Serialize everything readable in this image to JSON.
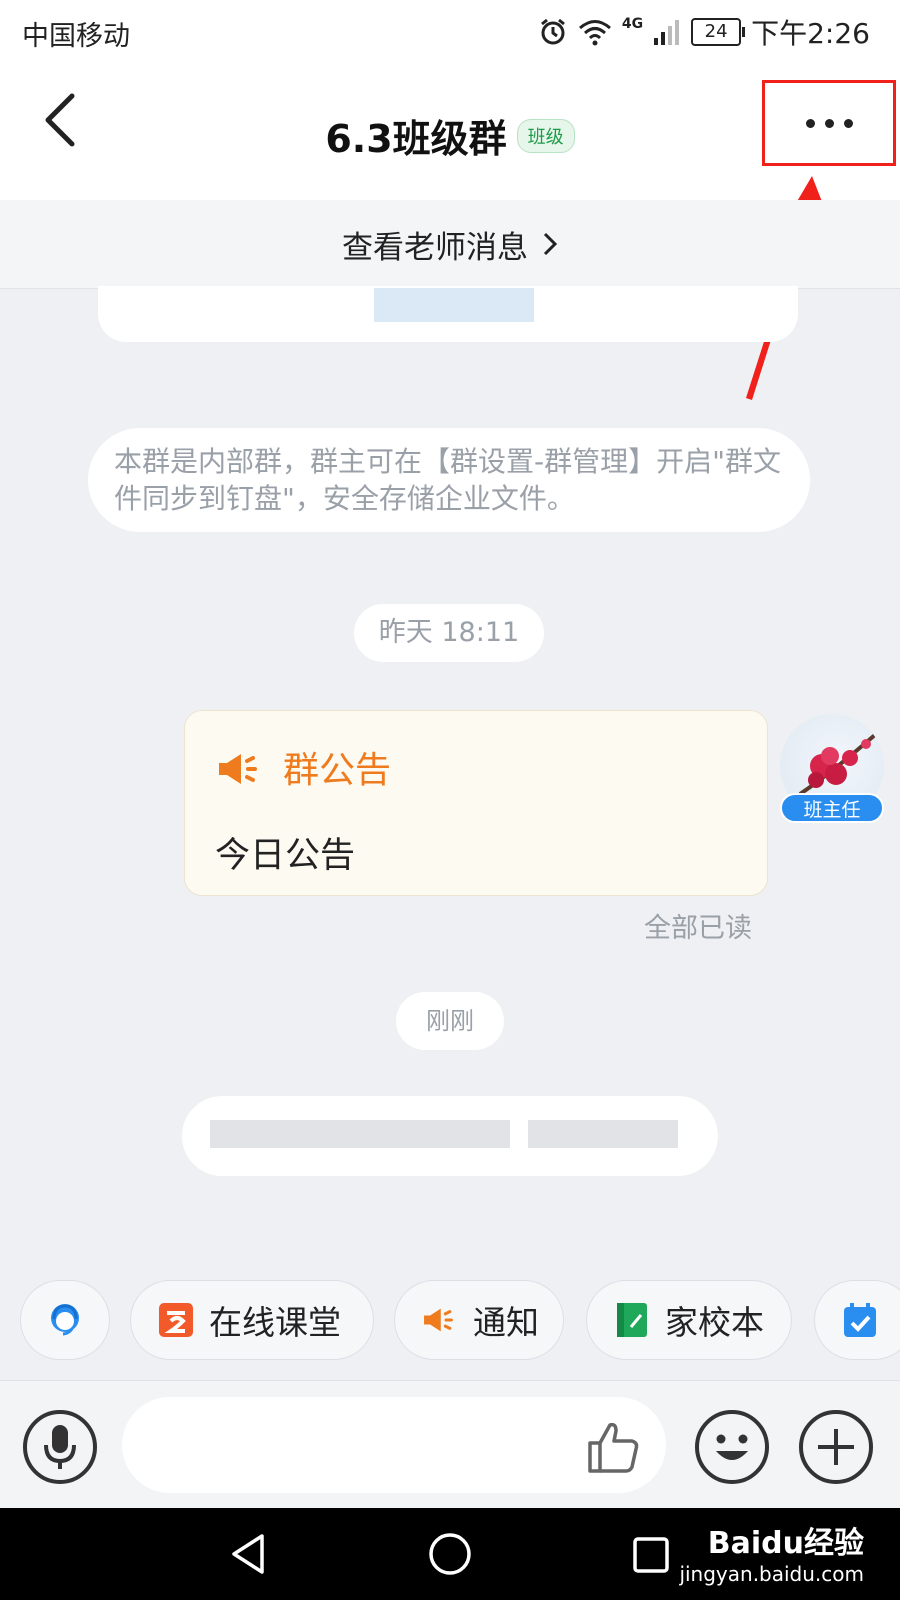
{
  "status_bar": {
    "carrier": "中国移动",
    "network": "4G",
    "battery": "24",
    "time": "下午2:26"
  },
  "header": {
    "title": "6.3班级群",
    "tag": "班级"
  },
  "teacher_bar": {
    "label": "查看老师消息"
  },
  "chat": {
    "system_notice": "本群是内部群，群主可在【群设置-群管理】开启\"群文件同步到钉盘\"，安全存储企业文件。",
    "time_1": "昨天 18:11",
    "announcement": {
      "title": "群公告",
      "body": "今日公告"
    },
    "read_status": "全部已读",
    "sender_role": "班主任",
    "time_2": "刚刚"
  },
  "quick_actions": [
    {
      "label": "在线课堂",
      "icon": "online-class-icon"
    },
    {
      "label": "通知",
      "icon": "megaphone-icon"
    },
    {
      "label": "家校本",
      "icon": "homework-book-icon"
    }
  ],
  "input_bar": {
    "placeholder": ""
  },
  "watermark": {
    "brand": "Baidu经验",
    "url": "jingyan.baidu.com"
  },
  "colors": {
    "accent_orange": "#ee7b1e",
    "highlight_red": "#f0201a",
    "badge_blue": "#2a8ef0",
    "tag_green": "#1e9a4a"
  }
}
